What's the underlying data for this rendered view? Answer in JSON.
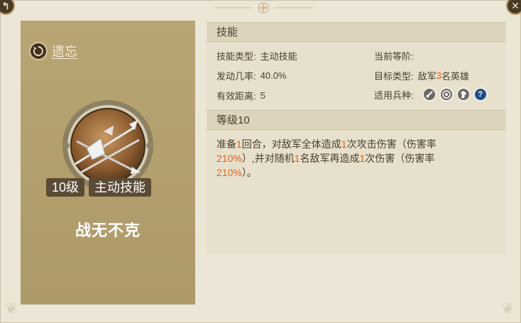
{
  "card": {
    "forget_label": "遗忘",
    "level_badge": "10级",
    "type_badge": "主动技能",
    "skill_name": "战无不克"
  },
  "skill_section": {
    "header": "技能",
    "type_key": "技能类型:",
    "type_value": "主动技能",
    "rank_key": "当前等阶:",
    "rank_value": "",
    "chance_key": "发动几率:",
    "chance_value": "40.0%",
    "target_key": "目标类型:",
    "target_prefix": "敌军",
    "target_count": "3",
    "target_suffix": "名英雄",
    "range_key": "有效距离:",
    "range_value": "5",
    "troops_key": "适用兵种:",
    "troop_icons": [
      "sword-icon",
      "target-icon",
      "horse-icon",
      "question-icon"
    ]
  },
  "level_section": {
    "header": "等级10",
    "desc": {
      "p1": "准备",
      "n1": "1",
      "p2": "回合，对敌军全体造成",
      "n2": "1",
      "p3": "次攻击伤害（伤害率",
      "n3": "210%",
      "p4": "）,并对随机",
      "n4": "1",
      "p5": "名敌军再造成",
      "n5": "1",
      "p6": "次伤害（伤害率",
      "n6": "210%",
      "p7": "）。"
    }
  },
  "colors": {
    "highlight": "#e0621c",
    "card_bg": "#b3a070",
    "panel_bg": "#ece6d6"
  }
}
